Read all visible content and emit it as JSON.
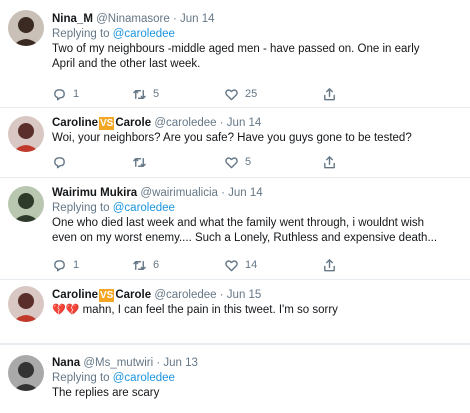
{
  "tweets": [
    {
      "name": "Nina_M",
      "handle": "@Ninamasore",
      "dot": "·",
      "date": "Jun 14",
      "replying_prefix": "Replying to",
      "replying_to": "@caroledee",
      "text_lines": [
        "Two of my neighbours -middle aged men - have passed on. One in early",
        "April and the other last week."
      ],
      "reply_count": "1",
      "retweet_count": "5",
      "like_count": "25",
      "avatar_bg": "#c9c0b8",
      "avatar_fg": "#3a2a22"
    },
    {
      "name_part1": "Caroline",
      "vs": "VS",
      "name_part2": "Carole",
      "handle": "@caroledee",
      "dot": "·",
      "date": "Jun 14",
      "text_lines": [
        "Woi, your neighbors? Are you safe? Have you guys gone to be tested?"
      ],
      "reply_count": "",
      "retweet_count": "",
      "like_count": "5",
      "avatar_bg": "#d8c7c2",
      "avatar_fg": "#5a2e2a"
    },
    {
      "name": "Wairimu Mukira",
      "handle": "@wairimualicia",
      "dot": "·",
      "date": "Jun 14",
      "replying_prefix": "Replying to",
      "replying_to": "@caroledee",
      "text_lines": [
        "One who died last week and what the family went through, i wouldnt wish",
        "even on my worst enemy.... Such a Lonely, Ruthless and expensive death..."
      ],
      "reply_count": "1",
      "retweet_count": "6",
      "like_count": "14",
      "avatar_bg": "#b9c6b0",
      "avatar_fg": "#2e3a2a"
    },
    {
      "name_part1": "Caroline",
      "vs": "VS",
      "name_part2": "Carole",
      "handle": "@caroledee",
      "dot": "·",
      "date": "Jun 15",
      "emoji_prefix": "💔💔",
      "text_lines": [
        " mahn, I can feel the pain in this tweet. I'm so sorry"
      ],
      "reply_count": "",
      "retweet_count": "",
      "like_count": "",
      "avatar_bg": "#d8c7c2",
      "avatar_fg": "#5a2e2a"
    },
    {
      "name": "Nana",
      "handle": "@Ms_mutwiri",
      "dot": "·",
      "date": "Jun 13",
      "replying_prefix": "Replying to",
      "replying_to": "@caroledee",
      "text_lines": [
        "The replies are scary"
      ],
      "avatar_bg": "#a9a9a9",
      "avatar_fg": "#333333"
    }
  ],
  "icons": [
    "reply-icon",
    "retweet-icon",
    "like-icon",
    "share-icon"
  ],
  "colors": {
    "mention": "#1b95e0",
    "secondary": "#657786",
    "vs_badge": "#f5a623"
  }
}
